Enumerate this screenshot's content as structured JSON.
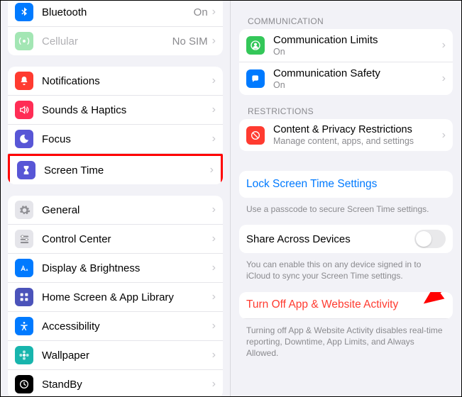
{
  "left": {
    "group1": [
      {
        "label": "Bluetooth",
        "value": "On",
        "iconColor": "#007aff"
      },
      {
        "label": "Cellular",
        "value": "No SIM",
        "iconColor": "#34c759",
        "muted": true
      }
    ],
    "group2": [
      {
        "label": "Notifications",
        "iconColor": "#ff3b30"
      },
      {
        "label": "Sounds & Haptics",
        "iconColor": "#ff2d55"
      },
      {
        "label": "Focus",
        "iconColor": "#5856d6"
      },
      {
        "label": "Screen Time",
        "iconColor": "#5856d6",
        "highlighted": true
      }
    ],
    "group3": [
      {
        "label": "General",
        "gray": true
      },
      {
        "label": "Control Center",
        "gray": true
      },
      {
        "label": "Display & Brightness",
        "iconColor": "#007aff"
      },
      {
        "label": "Home Screen & App Library",
        "iconColor": "#4b53ba"
      },
      {
        "label": "Accessibility",
        "iconColor": "#007aff"
      },
      {
        "label": "Wallpaper",
        "iconColor": "#18b5ad"
      },
      {
        "label": "StandBy",
        "iconColor": "#000000"
      }
    ]
  },
  "right": {
    "sections": {
      "communication_header": "Communication",
      "communication": [
        {
          "label": "Communication Limits",
          "sub": "On",
          "iconColor": "#34c759"
        },
        {
          "label": "Communication Safety",
          "sub": "On",
          "iconColor": "#007aff"
        }
      ],
      "restrictions_header": "Restrictions",
      "restrictions": [
        {
          "label": "Content & Privacy Restrictions",
          "sub": "Manage content, apps, and settings",
          "iconColor": "#ff3b30"
        }
      ],
      "lock_label": "Lock Screen Time Settings",
      "lock_footer": "Use a passcode to secure Screen Time settings.",
      "share_label": "Share Across Devices",
      "share_footer": "You can enable this on any device signed in to iCloud to sync your Screen Time settings.",
      "turnoff_label": "Turn Off App & Website Activity",
      "turnoff_footer": "Turning off App & Website Activity disables real-time reporting, Downtime, App Limits, and Always Allowed."
    }
  }
}
